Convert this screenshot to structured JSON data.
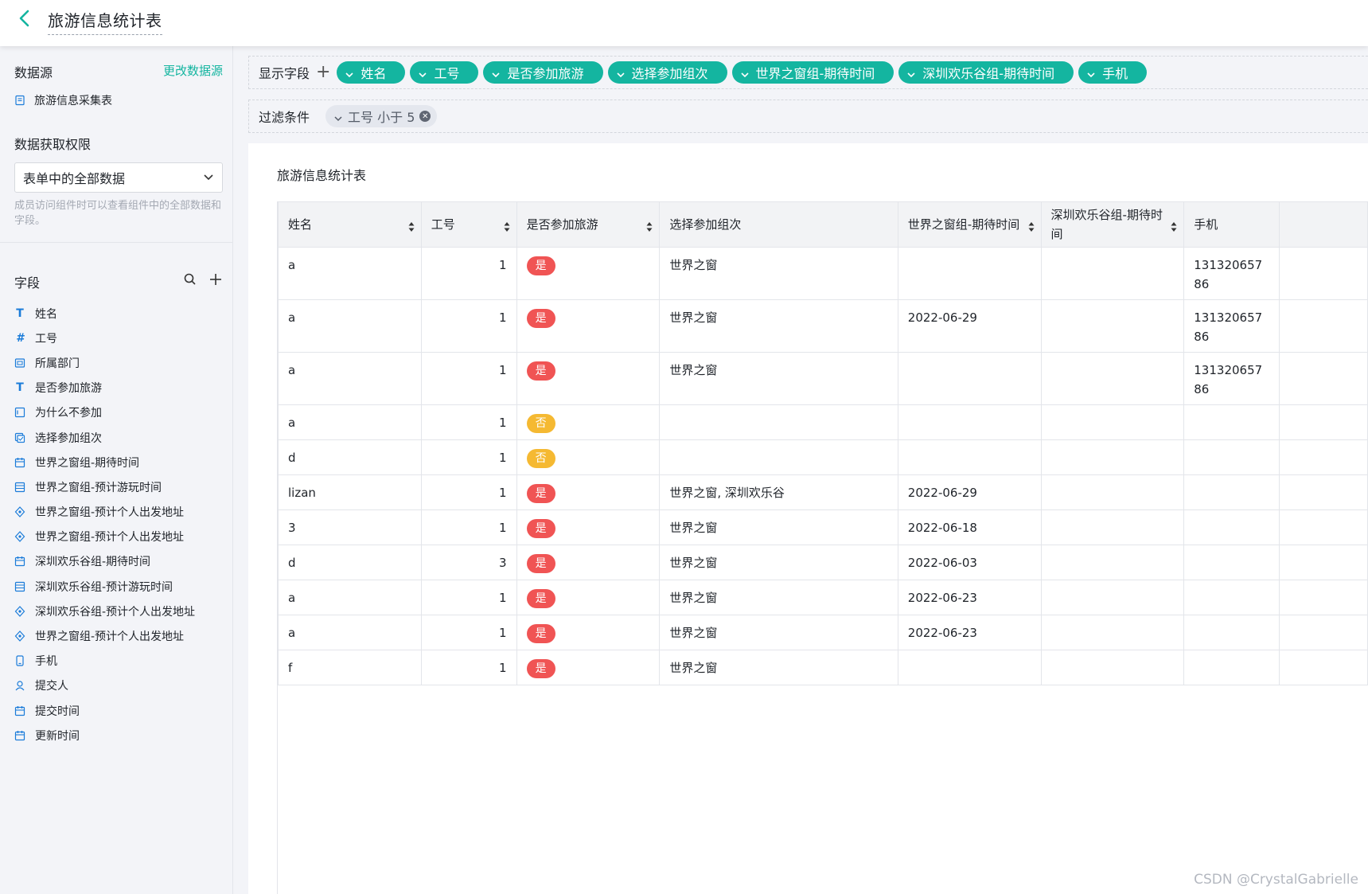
{
  "header": {
    "title": "旅游信息统计表"
  },
  "sidebar": {
    "datasource_label": "数据源",
    "change_datasource": "更改数据源",
    "datasource_item": "旅游信息采集表",
    "permission_label": "数据获取权限",
    "permission_select": "表单中的全部数据",
    "permission_hint": "成员访问组件时可以查看组件中的全部数据和字段。",
    "fields_label": "字段",
    "fields": [
      {
        "label": "姓名",
        "icon": "text-icon"
      },
      {
        "label": "工号",
        "icon": "number-icon"
      },
      {
        "label": "所属部门",
        "icon": "department-icon"
      },
      {
        "label": "是否参加旅游",
        "icon": "text-icon"
      },
      {
        "label": "为什么不参加",
        "icon": "textarea-icon"
      },
      {
        "label": "选择参加组次",
        "icon": "checkbox-icon"
      },
      {
        "label": "世界之窗组-期待时间",
        "icon": "date-icon"
      },
      {
        "label": "世界之窗组-预计游玩时间",
        "icon": "table-icon"
      },
      {
        "label": "世界之窗组-预计个人出发地址",
        "icon": "location-icon"
      },
      {
        "label": "世界之窗组-预计个人出发地址",
        "icon": "location-icon"
      },
      {
        "label": "深圳欢乐谷组-期待时间",
        "icon": "date-icon"
      },
      {
        "label": "深圳欢乐谷组-预计游玩时间",
        "icon": "table-icon"
      },
      {
        "label": "深圳欢乐谷组-预计个人出发地址",
        "icon": "location-icon"
      },
      {
        "label": "世界之窗组-预计个人出发地址",
        "icon": "location-icon"
      },
      {
        "label": "手机",
        "icon": "phone-icon"
      },
      {
        "label": "提交人",
        "icon": "user-icon"
      },
      {
        "label": "提交时间",
        "icon": "date-icon"
      },
      {
        "label": "更新时间",
        "icon": "date-icon"
      }
    ]
  },
  "display_fields": {
    "label": "显示字段",
    "chips": [
      "姓名",
      "工号",
      "是否参加旅游",
      "选择参加组次",
      "世界之窗组-期待时间",
      "深圳欢乐谷组-期待时间",
      "手机"
    ]
  },
  "filter": {
    "label": "过滤条件",
    "chip": "工号 小于 5"
  },
  "table": {
    "title": "旅游信息统计表",
    "columns": [
      "姓名",
      "工号",
      "是否参加旅游",
      "选择参加组次",
      "世界之窗组-期待时间",
      "深圳欢乐谷组-期待时间",
      "手机"
    ],
    "rows": [
      {
        "name": "a",
        "id": "1",
        "join": "是",
        "group": "世界之窗",
        "swc_date": "",
        "happy_date": "",
        "phone": "13132065786"
      },
      {
        "name": "a",
        "id": "1",
        "join": "是",
        "group": "世界之窗",
        "swc_date": "2022-06-29",
        "happy_date": "",
        "phone": "13132065786"
      },
      {
        "name": "a",
        "id": "1",
        "join": "是",
        "group": "世界之窗",
        "swc_date": "",
        "happy_date": "",
        "phone": "13132065786"
      },
      {
        "name": "a",
        "id": "1",
        "join": "否",
        "group": "",
        "swc_date": "",
        "happy_date": "",
        "phone": ""
      },
      {
        "name": "d",
        "id": "1",
        "join": "否",
        "group": "",
        "swc_date": "",
        "happy_date": "",
        "phone": ""
      },
      {
        "name": "lizan",
        "id": "1",
        "join": "是",
        "group": "世界之窗, 深圳欢乐谷",
        "swc_date": "2022-06-29",
        "happy_date": "",
        "phone": ""
      },
      {
        "name": "3",
        "id": "1",
        "join": "是",
        "group": "世界之窗",
        "swc_date": "2022-06-18",
        "happy_date": "",
        "phone": ""
      },
      {
        "name": "d",
        "id": "3",
        "join": "是",
        "group": "世界之窗",
        "swc_date": "2022-06-03",
        "happy_date": "",
        "phone": ""
      },
      {
        "name": "a",
        "id": "1",
        "join": "是",
        "group": "世界之窗",
        "swc_date": "2022-06-23",
        "happy_date": "",
        "phone": ""
      },
      {
        "name": "a",
        "id": "1",
        "join": "是",
        "group": "世界之窗",
        "swc_date": "2022-06-23",
        "happy_date": "",
        "phone": ""
      },
      {
        "name": "f",
        "id": "1",
        "join": "是",
        "group": "世界之窗",
        "swc_date": "",
        "happy_date": "",
        "phone": ""
      }
    ]
  },
  "colors": {
    "accent": "#14b5a0",
    "yes_badge": "#f05454",
    "no_badge": "#f5b932"
  },
  "watermark": "CSDN @CrystalGabrielle"
}
